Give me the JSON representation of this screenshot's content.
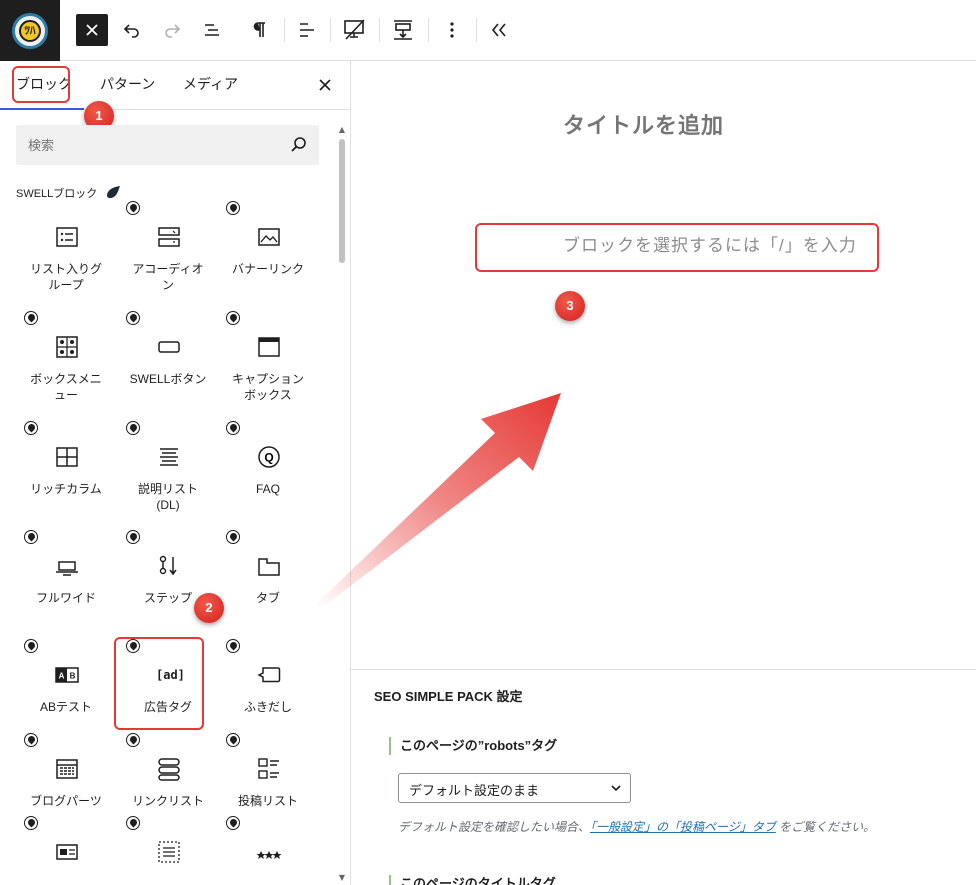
{
  "toolbar": {
    "logo_text": "ﾂﾊ",
    "buttons": [
      "close-icon",
      "undo-icon",
      "redo-icon",
      "list-view-icon",
      "paragraph-icon",
      "align-icon",
      "swell-device-icon",
      "block-spacing-icon",
      "more-options-icon",
      "collapse-icon"
    ]
  },
  "sidebar": {
    "tabs": [
      {
        "label": "ブロック"
      },
      {
        "label": "パターン"
      },
      {
        "label": "メディア"
      }
    ],
    "search_placeholder": "検索",
    "category_title": "SWELLブロック",
    "blocks": [
      {
        "label": "リスト入りグ\nループ",
        "icon": "list-group-icon",
        "swell": false
      },
      {
        "label": "アコーディオ\nン",
        "icon": "accordion-icon",
        "swell": true
      },
      {
        "label": "バナーリンク",
        "icon": "banner-link-icon",
        "swell": true
      },
      {
        "label": "ボックスメニ\nュー",
        "icon": "box-menu-icon",
        "swell": true
      },
      {
        "label": "SWELLボタン",
        "icon": "button-icon",
        "swell": true
      },
      {
        "label": "キャプション\nボックス",
        "icon": "caption-box-icon",
        "swell": true
      },
      {
        "label": "リッチカラム",
        "icon": "rich-column-icon",
        "swell": true
      },
      {
        "label": "説明リスト\n(DL)",
        "icon": "description-list-icon",
        "swell": true
      },
      {
        "label": "FAQ",
        "icon": "faq-icon",
        "swell": true
      },
      {
        "label": "フルワイド",
        "icon": "full-wide-icon",
        "swell": true
      },
      {
        "label": "ステップ",
        "icon": "step-icon",
        "swell": true
      },
      {
        "label": "タブ",
        "icon": "tab-icon",
        "swell": true
      },
      {
        "label": "ABテスト",
        "icon": "ab-test-icon",
        "swell": true
      },
      {
        "label": "広告タグ",
        "icon": "ad-tag-icon",
        "swell": true
      },
      {
        "label": "ふきだし",
        "icon": "balloon-icon",
        "swell": true
      },
      {
        "label": "ブログパーツ",
        "icon": "blog-parts-icon",
        "swell": true
      },
      {
        "label": "リンクリスト",
        "icon": "link-list-icon",
        "swell": true
      },
      {
        "label": "投稿リスト",
        "icon": "post-list-icon",
        "swell": true
      },
      {
        "label": "",
        "icon": "card-icon",
        "swell": true
      },
      {
        "label": "",
        "icon": "dashed-list-icon",
        "swell": true
      },
      {
        "label": "",
        "icon": "rating-icon",
        "swell": true
      }
    ],
    "ad_icon_text": "[ad]",
    "faq_icon_text": "Q",
    "ab_icon_text": "AB"
  },
  "annotations": [
    "1",
    "2",
    "3"
  ],
  "canvas": {
    "title_placeholder": "タイトルを追加",
    "block_placeholder": "ブロックを選択するには「/」を入力"
  },
  "seo": {
    "title": "SEO SIMPLE PACK 設定",
    "robots_label": "このページの”robots”タグ",
    "robots_value": "デフォルト設定のまま",
    "help_prefix": "デフォルト設定を確認したい場合、",
    "help_link": "「一般設定」の「投稿ページ」タブ",
    "help_suffix": "をご覧ください。",
    "title_tag_label": "このページのタイトルタグ"
  },
  "colors": {
    "accent": "#3858e9",
    "annotation_red": "#e53935",
    "dark": "#1e1e1e"
  }
}
